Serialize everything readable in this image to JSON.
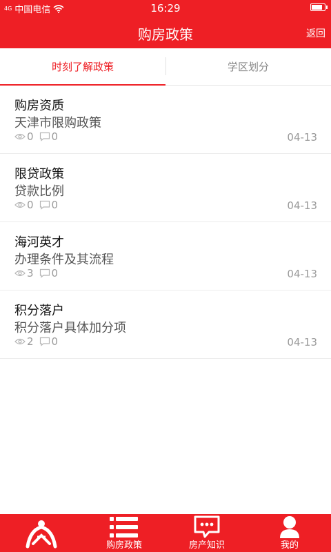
{
  "status_bar": {
    "carrier": "中国电信",
    "signal": "4G",
    "time": "16:29",
    "battery_level": 0.8
  },
  "header": {
    "title": "购房政策",
    "back_label": "返回"
  },
  "tabs": [
    {
      "label": "时刻了解政策",
      "active": true
    },
    {
      "label": "学区划分",
      "active": false
    }
  ],
  "items": [
    {
      "title": "购房资质",
      "subtitle": "天津市限购政策",
      "views": "0",
      "comments": "0",
      "date": "04-13"
    },
    {
      "title": "限贷政策",
      "subtitle": "贷款比例",
      "views": "0",
      "comments": "0",
      "date": "04-13"
    },
    {
      "title": "海河英才",
      "subtitle": "办理条件及其流程",
      "views": "3",
      "comments": "0",
      "date": "04-13"
    },
    {
      "title": "积分落户",
      "subtitle": "积分落户具体加分项",
      "views": "2",
      "comments": "0",
      "date": "04-13"
    }
  ],
  "bottom_nav": [
    {
      "label": "",
      "icon": "home-logo-icon"
    },
    {
      "label": "购房政策",
      "icon": "list-icon"
    },
    {
      "label": "房产知识",
      "icon": "chat-bubble-icon"
    },
    {
      "label": "我的",
      "icon": "person-icon"
    }
  ],
  "colors": {
    "accent": "#ee1f25",
    "muted": "#9a9a9a"
  }
}
